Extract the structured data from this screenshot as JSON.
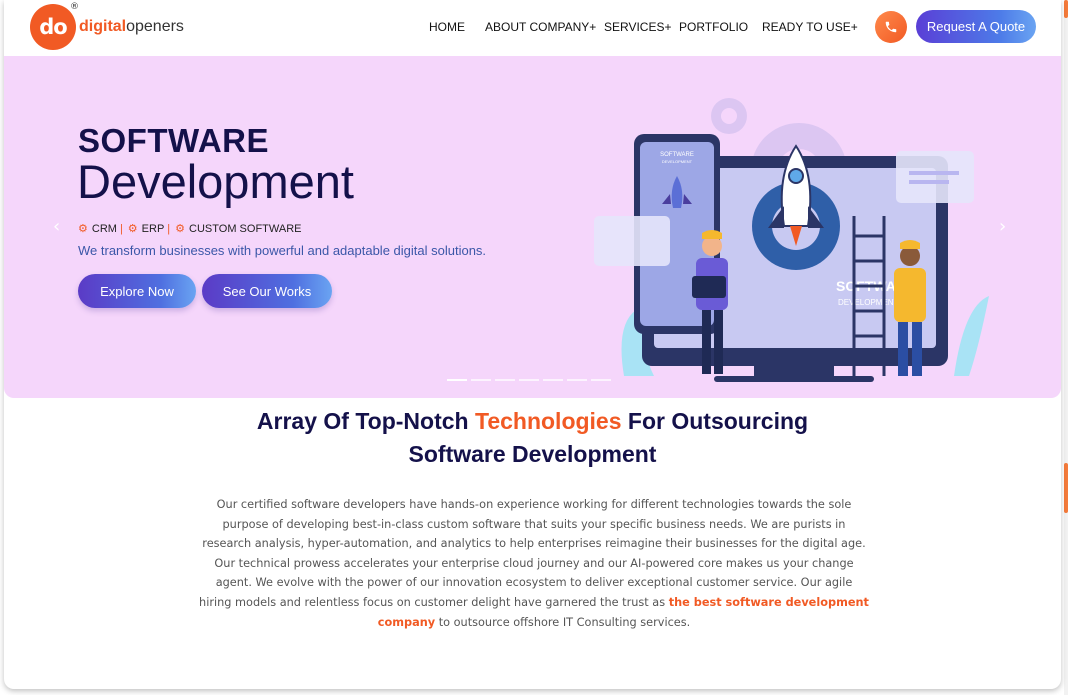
{
  "logo": {
    "mark": "do",
    "reg": "®",
    "text_accent": "digital",
    "text_rest": "openers"
  },
  "nav": {
    "items": [
      {
        "label": "HOME"
      },
      {
        "label": "ABOUT COMPANY+"
      },
      {
        "label": "SERVICES+"
      },
      {
        "label": "PORTFOLIO"
      },
      {
        "label": "READY TO USE+"
      }
    ],
    "phone_icon": "phone-icon",
    "quote_label": "Request A Quote"
  },
  "hero": {
    "title_line1": "SOFTWARE",
    "title_line2": "Development",
    "tags": [
      "CRM",
      "ERP",
      "CUSTOM SOFTWARE"
    ],
    "description": "We transform businesses with powerful and adaptable digital solutions.",
    "explore_label": "Explore Now",
    "works_label": "See Our Works",
    "prev_arrow": "‹",
    "next_arrow": "›",
    "slide_count": 7,
    "active_slide": 1,
    "illustration": {
      "screen_title": "SOFTWARE",
      "screen_subtitle": "DEVELOPMENT",
      "phone_title": "SOFTWARE",
      "phone_subtitle": "DEVELOPMENT"
    }
  },
  "section": {
    "title_pre": "Array Of Top-Notch ",
    "title_highlight": "Technologies",
    "title_post": " For Outsourcing",
    "title_line2": "Software Development",
    "body_pre": "Our certified software developers have hands-on experience working for different technologies towards the sole purpose of developing best-in-class custom software that suits your specific business needs. We are purists in research analysis, hyper-automation, and analytics to help enterprises reimagine their businesses for the digital age. Our technical prowess accelerates your enterprise cloud journey and our AI-powered core makes us your change agent. We evolve with the power of our innovation ecosystem to deliver exceptional customer service. Our agile hiring models and relentless focus on customer delight have garnered the trust as ",
    "body_strong": "the best software development company",
    "body_post": " to outsource offshore IT Consulting services."
  },
  "colors": {
    "brand_orange": "#f15a24",
    "navy": "#14114a",
    "hero_bg": "#f5d6fb",
    "button_gradient_start": "#5b3bc6",
    "button_gradient_end": "#6aa4f2"
  }
}
